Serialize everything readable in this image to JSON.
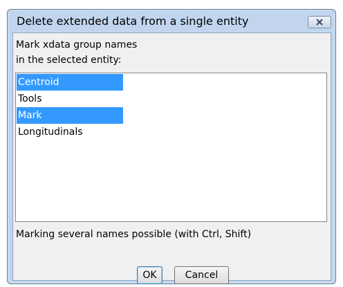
{
  "dialog": {
    "title": "Delete extended data from a single entity",
    "close_icon": "close-icon"
  },
  "prompt": {
    "line1": "Mark xdata group names",
    "line2": "in the selected entity:"
  },
  "list": {
    "items": [
      {
        "label": "Centroid",
        "selected": true
      },
      {
        "label": "Tools",
        "selected": false
      },
      {
        "label": "Mark",
        "selected": true
      },
      {
        "label": "Longitudinals",
        "selected": false
      }
    ]
  },
  "hint": "Marking several names possible (with Ctrl, Shift)",
  "buttons": {
    "ok": "OK",
    "cancel": "Cancel"
  },
  "colors": {
    "selection": "#3399ff",
    "frame": "#c1d6ee"
  }
}
